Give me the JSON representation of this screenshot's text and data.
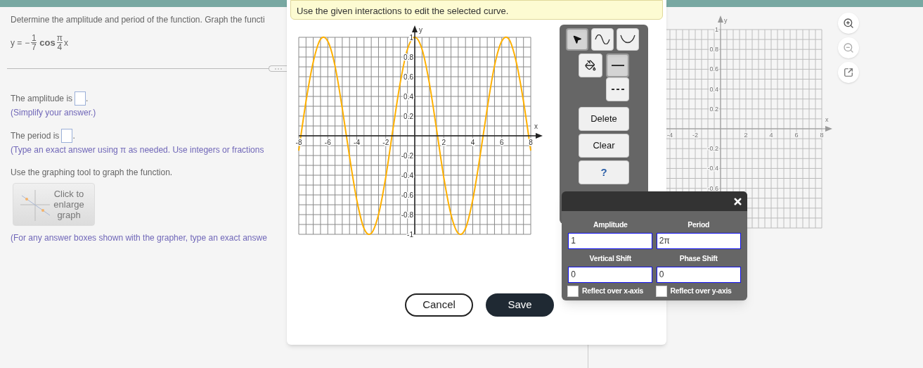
{
  "question": {
    "prompt": "Determine the amplitude and period of the function. Graph the functi",
    "equation": {
      "lhs": "y =",
      "sign": "−",
      "coefficient": {
        "numerator": "1",
        "denominator": "7"
      },
      "function": "cos",
      "argument": {
        "numerator": "π",
        "denominator": "4"
      },
      "variable": "x"
    },
    "answers": [
      {
        "label": "The amplitude is",
        "end": ".",
        "hint": "(Simplify your answer.)"
      },
      {
        "label": "The period is",
        "end": ".",
        "hint": "(Type an exact answer using π as needed. Use integers or fractions"
      }
    ],
    "graph_prompt": "Use the graphing tool to graph the function.",
    "enlarge_button": "Click to enlarge graph",
    "footnote": "(For any answer boxes shown with the grapher, type an exact answe"
  },
  "background_graph": {
    "x_label": "x",
    "y_label": "y",
    "x_ticks": [
      "-4",
      "-2",
      "2",
      "4",
      "6",
      "8"
    ],
    "y_ticks": [
      "1",
      "0.8",
      "0.6",
      "0.4",
      "0.2",
      "-0.2",
      "-0.4",
      "-0.6"
    ]
  },
  "graph_editor": {
    "instruction_banner": "Use the given interactions to edit the selected curve.",
    "chart_data": {
      "type": "line",
      "grid": true,
      "xlabel": "x",
      "ylabel": "y",
      "xlim": [
        -8,
        8
      ],
      "ylim": [
        -1,
        1
      ],
      "xticks": [
        -8,
        -6,
        -4,
        -2,
        2,
        4,
        6,
        8
      ],
      "yticks": [
        -1,
        -0.8,
        -0.6,
        -0.4,
        -0.2,
        0.2,
        0.4,
        0.6,
        0.8,
        1
      ],
      "x": [
        -8,
        -7.5,
        -7,
        -6.5,
        -6,
        -5.5,
        -5,
        -4.5,
        -4,
        -3.5,
        -3,
        -2.5,
        -2,
        -1.5,
        -1,
        -0.5,
        0,
        0.5,
        1,
        1.5,
        2,
        2.5,
        3,
        3.5,
        4,
        4.5,
        5,
        5.5,
        6,
        6.5,
        7,
        7.5,
        8
      ],
      "series": [
        {
          "color": "#ffb000",
          "values": [
            -0.15,
            0.35,
            0.75,
            0.98,
            0.96,
            0.71,
            0.28,
            -0.21,
            -0.65,
            -0.94,
            -0.99,
            -0.8,
            -0.42,
            0.07,
            0.54,
            0.88,
            1,
            0.88,
            0.54,
            0.07,
            -0.42,
            -0.8,
            -0.99,
            -0.94,
            -0.65,
            -0.21,
            0.28,
            0.71,
            0.96,
            0.98,
            0.75,
            0.35,
            -0.15
          ]
        }
      ]
    },
    "tools": [
      {
        "kind": "select",
        "selected": true
      },
      {
        "kind": "sine",
        "selected": false
      },
      {
        "kind": "parabola",
        "selected": false
      }
    ],
    "line_styles": [
      {
        "kind": "solid",
        "selected": true
      },
      {
        "kind": "dashed",
        "selected": false
      }
    ],
    "actions": [
      {
        "kind": "delete",
        "label": "Delete"
      },
      {
        "kind": "clear",
        "label": "Clear"
      },
      {
        "kind": "help",
        "label": "?"
      }
    ],
    "properties": {
      "fields": [
        {
          "label": "Amplitude",
          "value": "1"
        },
        {
          "label": "Period",
          "value": "2π"
        },
        {
          "label": "Vertical Shift",
          "value": "0"
        },
        {
          "label": "Phase Shift",
          "value": "0"
        }
      ],
      "checkboxes": [
        {
          "label": "Reflect over x-axis",
          "checked": false
        },
        {
          "label": "Reflect over y-axis",
          "checked": false
        }
      ]
    },
    "buttons": [
      {
        "kind": "secondary",
        "label": "Cancel"
      },
      {
        "kind": "primary",
        "label": "Save"
      }
    ]
  }
}
